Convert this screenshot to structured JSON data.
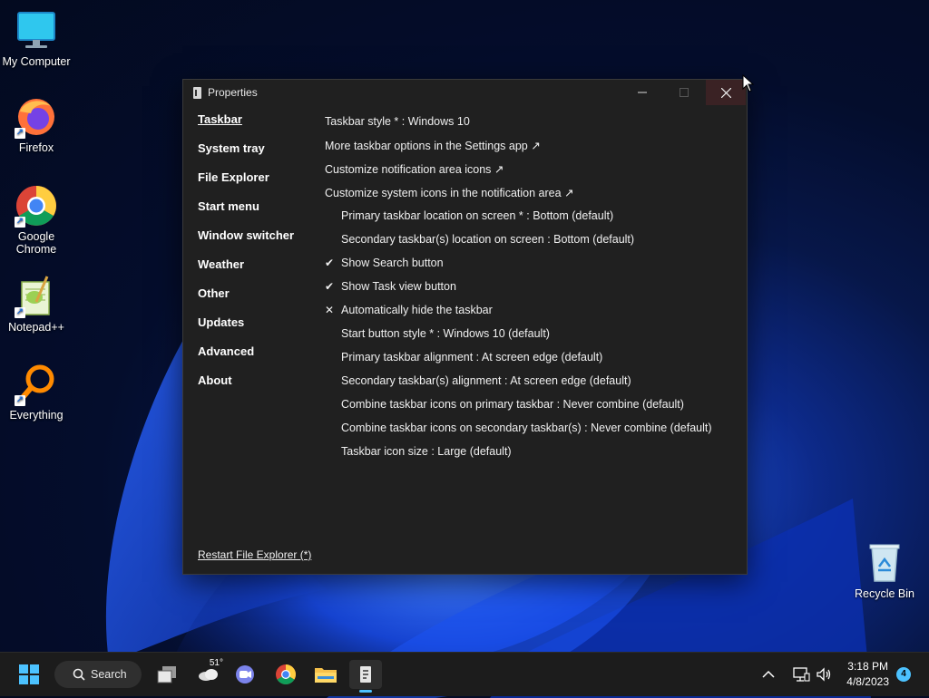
{
  "desktop": {
    "icons": [
      {
        "label": "My Computer",
        "icon": "monitor-icon"
      },
      {
        "label": "Firefox",
        "icon": "firefox-icon"
      },
      {
        "label": "Google Chrome",
        "icon": "chrome-icon"
      },
      {
        "label": "Notepad++",
        "icon": "notepadpp-icon"
      },
      {
        "label": "Everything",
        "icon": "everything-icon"
      },
      {
        "label": "Recycle Bin",
        "icon": "recycle-bin-icon"
      }
    ]
  },
  "window": {
    "title": "Properties",
    "nav": [
      {
        "label": "Taskbar",
        "active": true
      },
      {
        "label": "System tray"
      },
      {
        "label": "File Explorer"
      },
      {
        "label": "Start menu"
      },
      {
        "label": "Window switcher"
      },
      {
        "label": "Weather"
      },
      {
        "label": "Other"
      },
      {
        "label": "Updates"
      },
      {
        "label": "Advanced"
      },
      {
        "label": "About"
      }
    ],
    "options": [
      {
        "label": "Taskbar style * : Windows 10",
        "indent": false,
        "mark": ""
      },
      {
        "label": "More taskbar options in the Settings app ↗",
        "indent": false,
        "mark": ""
      },
      {
        "label": "Customize notification area icons ↗",
        "indent": false,
        "mark": ""
      },
      {
        "label": "Customize system icons in the notification area ↗",
        "indent": false,
        "mark": ""
      },
      {
        "label": "Primary taskbar location on screen * : Bottom (default)",
        "indent": true,
        "mark": ""
      },
      {
        "label": "Secondary taskbar(s) location on screen : Bottom (default)",
        "indent": true,
        "mark": ""
      },
      {
        "label": "Show Search button",
        "indent": true,
        "mark": "✔"
      },
      {
        "label": "Show Task view button",
        "indent": true,
        "mark": "✔"
      },
      {
        "label": "Automatically hide the taskbar",
        "indent": true,
        "mark": "✕"
      },
      {
        "label": "Start button style * : Windows 10 (default)",
        "indent": true,
        "mark": ""
      },
      {
        "label": "Primary taskbar alignment : At screen edge (default)",
        "indent": true,
        "mark": ""
      },
      {
        "label": "Secondary taskbar(s) alignment : At screen edge (default)",
        "indent": true,
        "mark": ""
      },
      {
        "label": "Combine taskbar icons on primary taskbar : Never combine (default)",
        "indent": true,
        "mark": ""
      },
      {
        "label": "Combine taskbar icons on secondary taskbar(s) : Never combine (default)",
        "indent": true,
        "mark": ""
      },
      {
        "label": "Taskbar icon size : Large (default)",
        "indent": true,
        "mark": ""
      }
    ],
    "restart_label": "Restart File Explorer (*)"
  },
  "taskbar": {
    "search_label": "Search",
    "weather_temp": "51°",
    "time": "3:18 PM",
    "date": "4/8/2023",
    "notification_count": "4"
  }
}
